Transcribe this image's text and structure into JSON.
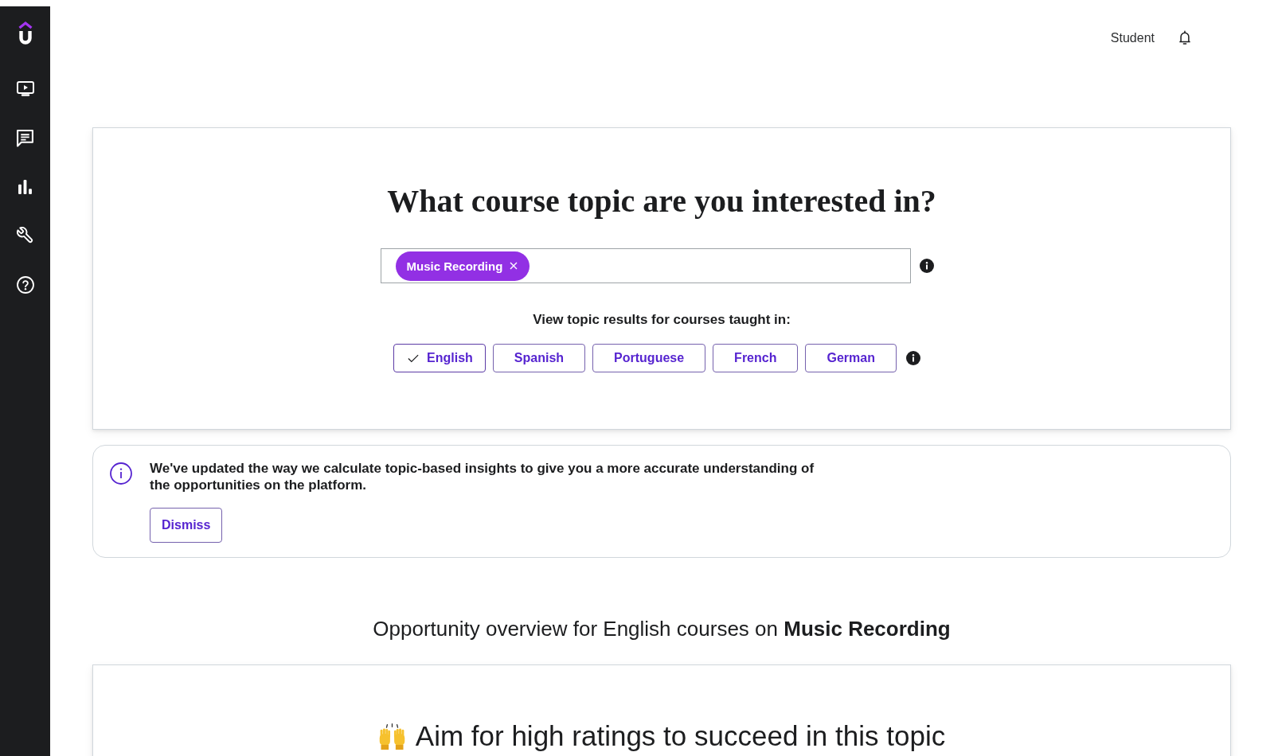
{
  "header": {
    "user_menu": "Student"
  },
  "topic_search": {
    "title": "What course topic are you interested in?",
    "chips": [
      {
        "label": "Music Recording"
      }
    ]
  },
  "language_filter": {
    "label": "View topic results for courses taught in:",
    "options": [
      {
        "label": "English",
        "selected": true
      },
      {
        "label": "Spanish",
        "selected": false
      },
      {
        "label": "Portuguese",
        "selected": false
      },
      {
        "label": "French",
        "selected": false
      },
      {
        "label": "German",
        "selected": false
      }
    ]
  },
  "notice": {
    "message": "We've updated the way we calculate topic-based insights to give you a more accurate understanding of the opportunities on the platform.",
    "button": "Dismiss"
  },
  "overview_title": "Opportunity overview for English courses on **Music Recording**",
  "insight_card": {
    "title": "Aim for high ratings to succeed in this topic"
  }
}
